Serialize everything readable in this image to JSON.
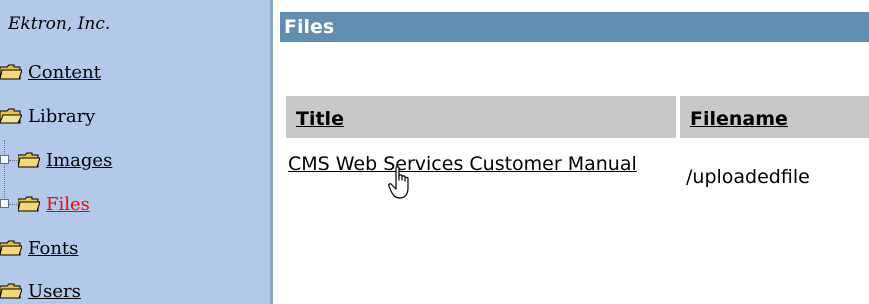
{
  "tree": {
    "org_name": "Ektron, Inc.",
    "items": [
      {
        "label": "Content",
        "icon": "folder-icon"
      },
      {
        "label": "Library",
        "icon": "folder-open-icon"
      },
      {
        "label": "Images",
        "icon": "folder-icon"
      },
      {
        "label": "Files",
        "icon": "folder-icon"
      },
      {
        "label": "Fonts",
        "icon": "folder-icon"
      },
      {
        "label": "Users",
        "icon": "folder-icon"
      }
    ]
  },
  "main": {
    "header": "Files",
    "columns": [
      "Title",
      "Filename"
    ],
    "rows": [
      {
        "title": "CMS Web Services Customer Manual",
        "filename": "/uploadedfile"
      }
    ]
  },
  "colors": {
    "tree_bg": "#b3c9e9",
    "header_bg": "#5f8fb0",
    "column_header_bg": "#c8c8c8",
    "active_link": "#ff0000"
  }
}
